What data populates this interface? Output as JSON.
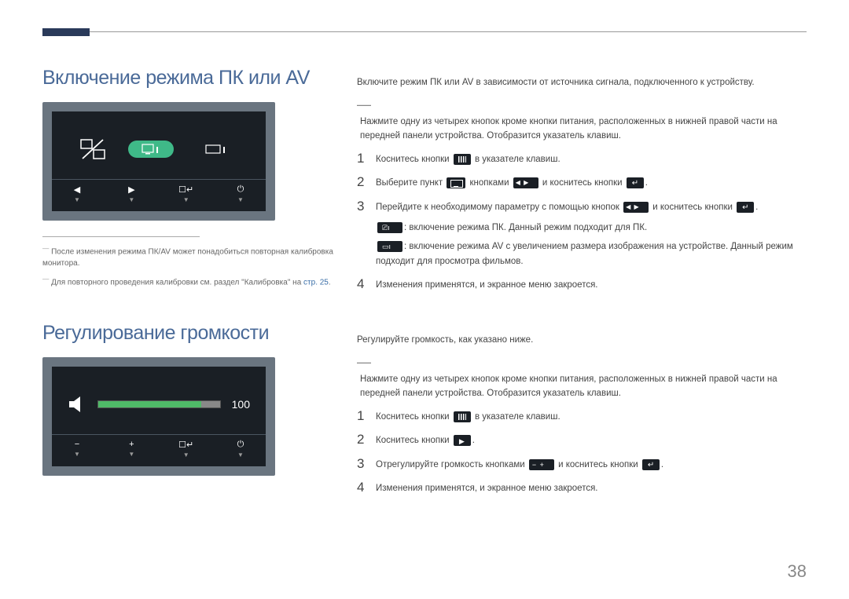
{
  "page_number": "38",
  "section1": {
    "heading": "Включение режима ПК или AV",
    "intro": "Включите режим ПК или AV в зависимости от источника сигнала, подключенного к устройству.",
    "note": "Нажмите одну из четырех кнопок кроме кнопки питания, расположенных в нижней правой части на передней панели устройства. Отобразится указатель клавиш.",
    "steps": [
      {
        "n": "1",
        "pre": "Коснитесь кнопки ",
        "post": " в указателе клавиш."
      },
      {
        "n": "2",
        "a": "Выберите пункт ",
        "b": " кнопками ",
        "c": " и коснитесь кнопки ",
        "d": "."
      },
      {
        "n": "3",
        "a": "Перейдите к необходимому параметру с помощью кнопок ",
        "b": " и коснитесь кнопки ",
        "c": ".",
        "pc": ": включение режима ПК. Данный режим подходит для ПК.",
        "av": ": включение режима AV с увеличением размера изображения на устройстве. Данный режим подходит для просмотра фильмов."
      },
      {
        "n": "4",
        "text": "Изменения применятся, и экранное меню закроется."
      }
    ],
    "footnotes": [
      "После изменения режима ПК/AV может понадобиться повторная калибровка монитора.",
      {
        "a": "Для повторного проведения калибровки см. раздел \"Калибровка\" на ",
        "link": "стр. 25",
        "b": "."
      }
    ]
  },
  "section2": {
    "heading": "Регулирование громкости",
    "volume_value": "100",
    "intro": "Регулируйте громкость, как указано ниже.",
    "note": "Нажмите одну из четырех кнопок кроме кнопки питания, расположенных в нижней правой части на передней панели устройства. Отобразится указатель клавиш.",
    "steps": [
      {
        "n": "1",
        "pre": "Коснитесь кнопки ",
        "post": " в указателе клавиш."
      },
      {
        "n": "2",
        "pre": "Коснитесь кнопки ",
        "post": "."
      },
      {
        "n": "3",
        "a": "Отрегулируйте громкость кнопками ",
        "b": " и коснитесь кнопки ",
        "c": "."
      },
      {
        "n": "4",
        "text": "Изменения применятся, и экранное меню закроется."
      }
    ]
  }
}
